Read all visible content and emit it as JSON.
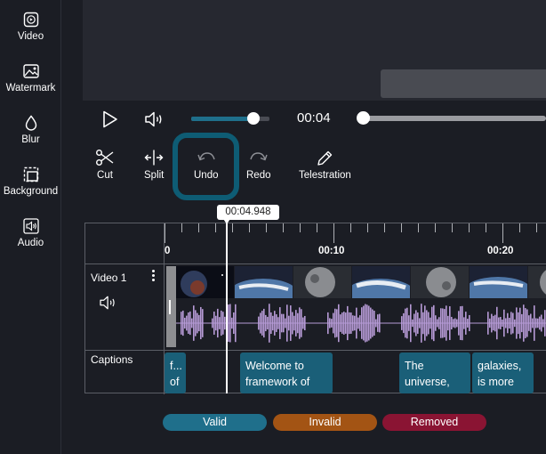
{
  "sidebar": {
    "items": [
      {
        "label": "Video",
        "icon": "video-icon"
      },
      {
        "label": "Watermark",
        "icon": "watermark-icon"
      },
      {
        "label": "Blur",
        "icon": "blur-icon"
      },
      {
        "label": "Background",
        "icon": "background-icon"
      },
      {
        "label": "Audio",
        "icon": "audio-icon"
      }
    ]
  },
  "player": {
    "current_time": "00:04",
    "volume_level": 0.8,
    "seek_progress": 0.0
  },
  "tools": {
    "items": [
      {
        "label": "Cut",
        "icon": "scissors-icon"
      },
      {
        "label": "Split",
        "icon": "split-icon"
      },
      {
        "label": "Undo",
        "icon": "undo-icon",
        "highlighted": true
      },
      {
        "label": "Redo",
        "icon": "redo-icon"
      },
      {
        "label": "Telestration",
        "icon": "pencil-icon"
      }
    ]
  },
  "timeline": {
    "playhead_time": "00:04.948",
    "ticks": [
      "0",
      "00:10",
      "00:20"
    ],
    "tracks": [
      {
        "name": "Video 1"
      },
      {
        "name": "Captions"
      }
    ],
    "captions": [
      {
        "text": "f... of",
        "status": "valid"
      },
      {
        "text": "Welcome to framework of",
        "status": "valid"
      },
      {
        "text": "The universe,",
        "status": "valid"
      },
      {
        "text": "galaxies, is more",
        "status": "valid"
      }
    ]
  },
  "legend": {
    "valid": "Valid",
    "invalid": "Invalid",
    "removed": "Removed"
  },
  "colors": {
    "accent": "#1f6f8b",
    "highlight_ring": "#0e5c74",
    "caption_bg": "#1a5f78",
    "waveform": "#b69ad6",
    "valid": "#1f6f8b",
    "invalid": "#a35414",
    "removed": "#8a1433"
  }
}
